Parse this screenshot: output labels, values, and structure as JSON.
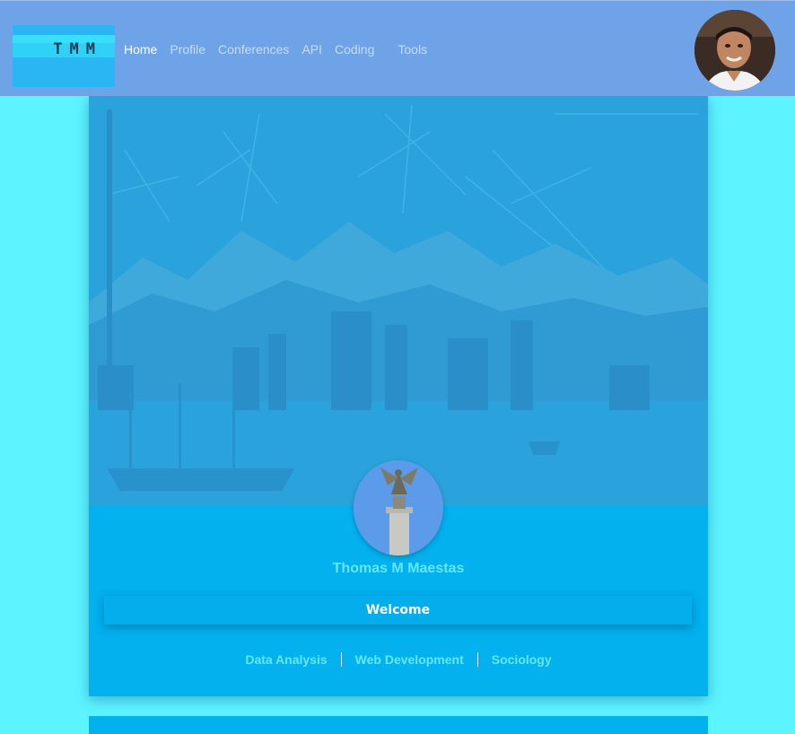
{
  "navbar": {
    "logo_text": "TMM",
    "links": [
      {
        "label": "Home",
        "active": true
      },
      {
        "label": "Profile",
        "active": false
      },
      {
        "label": "Conferences",
        "active": false
      },
      {
        "label": "API",
        "active": false
      },
      {
        "label": "Coding",
        "active": false
      },
      {
        "label": "Tools",
        "active": false
      }
    ]
  },
  "hero": {
    "name": "Thomas M Maestas",
    "welcome": "Welcome",
    "tags": [
      "Data Analysis",
      "Web Development",
      "Sociology"
    ]
  },
  "colors": {
    "page_background": "#5cf4ff",
    "navbar": "#6fa3e8",
    "card": "#02b1ee",
    "accent_text": "#62e8ff"
  }
}
